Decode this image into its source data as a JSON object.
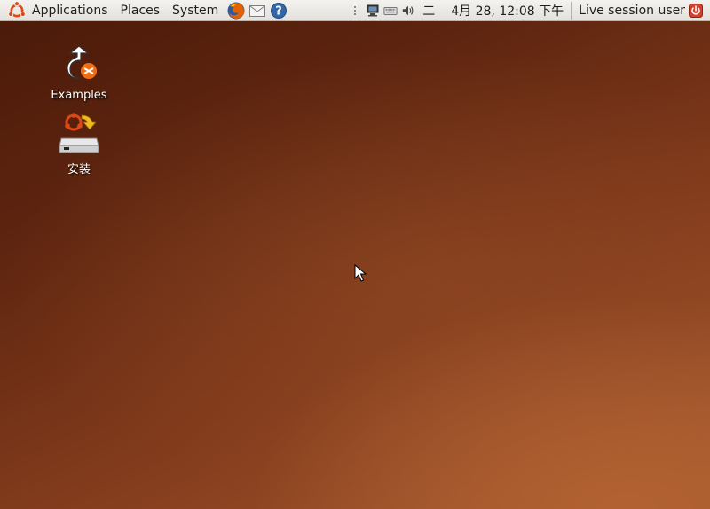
{
  "panel": {
    "menus": {
      "applications": "Applications",
      "places": "Places",
      "system": "System"
    },
    "launchers": [
      "firefox-icon",
      "mail-icon",
      "help-icon"
    ],
    "tray_icons": [
      "network-icon",
      "keyboard-icon",
      "volume-icon"
    ],
    "weekday": "二",
    "clock": "4月 28, 12:08 下午",
    "user": "Live session user"
  },
  "desktop": {
    "icons": [
      {
        "label": "Examples",
        "icon": "examples-icon"
      },
      {
        "label": "安装",
        "icon": "install-icon"
      }
    ]
  },
  "colors": {
    "panel_bg": "#e8e6e1",
    "desktop_dark": "#4a1a08",
    "desktop_light": "#b26232",
    "ubuntu_orange": "#dd4814"
  }
}
